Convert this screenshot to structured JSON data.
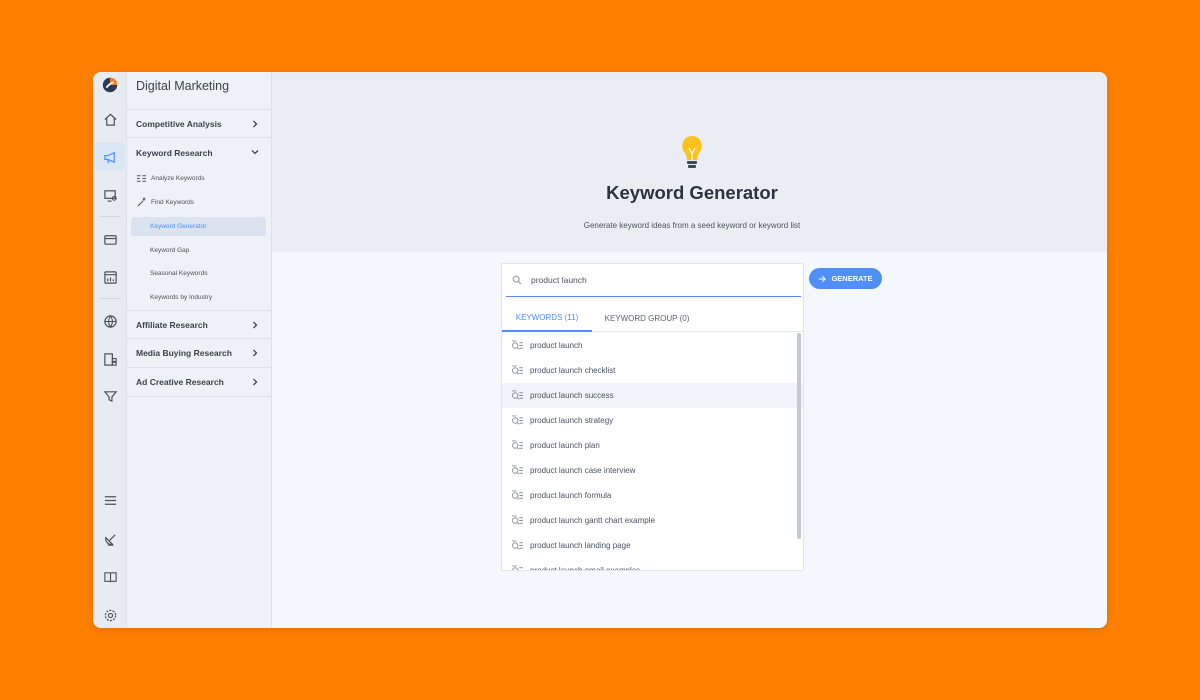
{
  "nav": {
    "title": "Digital Marketing",
    "sections": [
      {
        "label": "Competitive Analysis"
      },
      {
        "label": "Keyword Research"
      },
      {
        "label": "Affiliate Research"
      },
      {
        "label": "Media Buying Research"
      },
      {
        "label": "Ad Creative Research"
      }
    ],
    "keyword_research_items": [
      {
        "label": "Analyze Keywords"
      },
      {
        "label": "Find Keywords"
      },
      {
        "label": "Keyword Generator"
      },
      {
        "label": "Keyword Gap"
      },
      {
        "label": "Seasonal Keywords"
      },
      {
        "label": "Keywords by Industry"
      }
    ]
  },
  "hero": {
    "title": "Keyword Generator",
    "subtitle": "Generate keyword ideas from a seed keyword or keyword list"
  },
  "search": {
    "value": "product launch"
  },
  "generate_label": "GENERATE",
  "tabs": [
    {
      "label": "KEYWORDS (11)"
    },
    {
      "label": "KEYWORD GROUP (0)"
    }
  ],
  "keywords": [
    "product launch",
    "product launch checklist",
    "product launch success",
    "product launch strategy",
    "product launch plan",
    "product launch case interview",
    "product launch formula",
    "product launch gantt chart example",
    "product launch landing page",
    "product launch email examples"
  ],
  "colors": {
    "accent": "#4f8ff7",
    "background": "#ff8000"
  }
}
